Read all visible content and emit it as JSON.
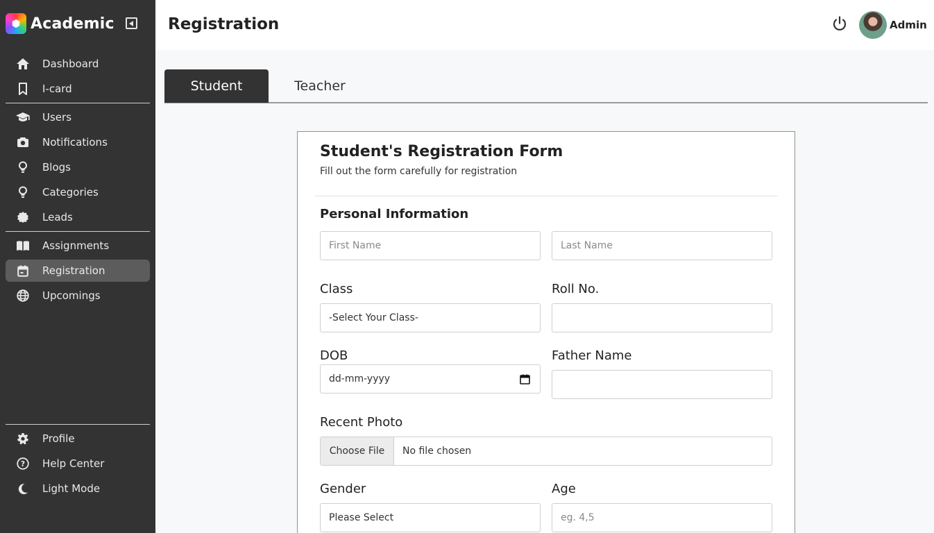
{
  "brand": {
    "name": "Academic"
  },
  "sidebar": {
    "items": [
      {
        "label": "Dashboard",
        "icon": "home-icon"
      },
      {
        "label": "I-card",
        "icon": "bookmark-icon"
      },
      {
        "label": "Users",
        "icon": "graduation-cap-icon"
      },
      {
        "label": "Notifications",
        "icon": "camera-icon"
      },
      {
        "label": "Blogs",
        "icon": "lightbulb-icon"
      },
      {
        "label": "Categories",
        "icon": "lightbulb-icon"
      },
      {
        "label": "Leads",
        "icon": "badge-icon"
      },
      {
        "label": "Assignments",
        "icon": "book-open-icon"
      },
      {
        "label": "Registration",
        "icon": "calendar-icon",
        "active": true
      },
      {
        "label": "Upcomings",
        "icon": "globe-icon"
      }
    ],
    "bottom_items": [
      {
        "label": "Profile",
        "icon": "gear-icon"
      },
      {
        "label": "Help Center",
        "icon": "help-icon"
      },
      {
        "label": "Light Mode",
        "icon": "moon-icon"
      }
    ]
  },
  "header": {
    "title": "Registration",
    "user_name": "Admin"
  },
  "tabs": [
    {
      "label": "Student",
      "active": true
    },
    {
      "label": "Teacher",
      "active": false
    }
  ],
  "form": {
    "title": "Student's Registration Form",
    "subtitle": "Fill out the form carefully for registration",
    "section_personal": "Personal Information",
    "first_name_placeholder": "First Name",
    "last_name_placeholder": "Last Name",
    "class_label": "Class",
    "class_value": "-Select Your Class-",
    "roll_label": "Roll No.",
    "dob_label": "DOB",
    "dob_value": "dd-mm-yyyy",
    "father_label": "Father Name",
    "photo_label": "Recent Photo",
    "file_button": "Choose File",
    "file_status": "No file chosen",
    "gender_label": "Gender",
    "gender_value": "Please Select",
    "age_label": "Age",
    "age_placeholder": "eg. 4,5"
  },
  "colors": {
    "sidebar_bg": "#333333",
    "active_item_bg": "#5c5c5c",
    "header_bg": "#ffffff",
    "content_bg": "#f7f8fa"
  }
}
